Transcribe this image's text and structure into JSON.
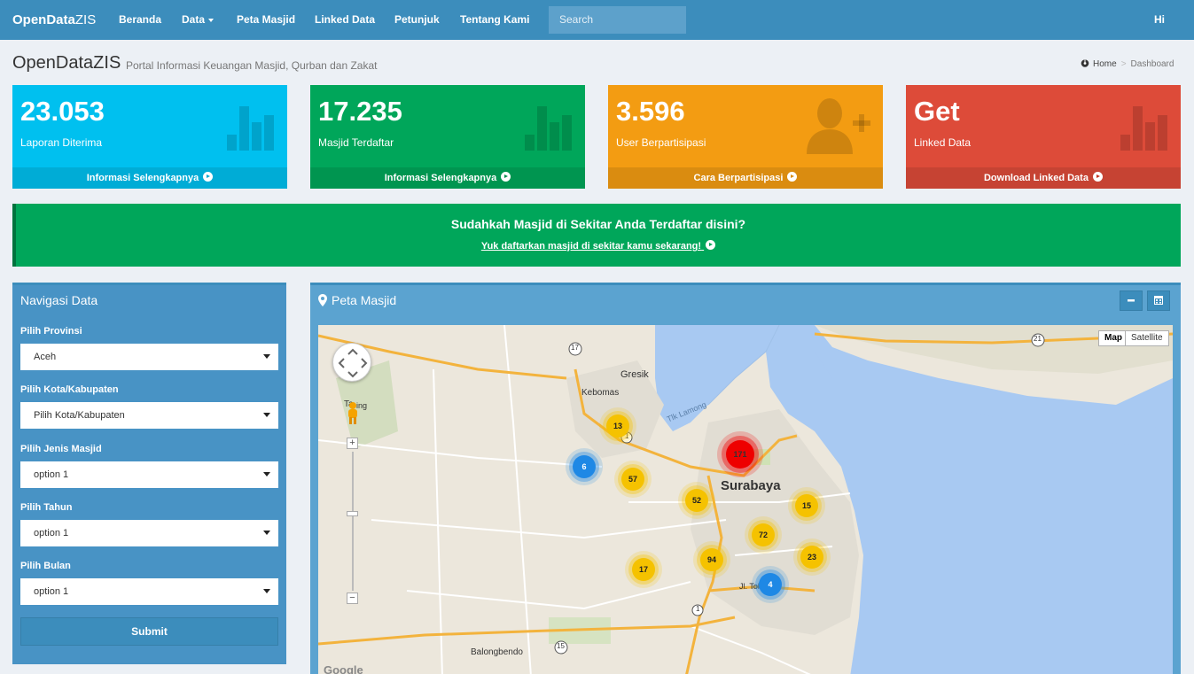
{
  "brand": {
    "bold": "OpenData",
    "light": "ZIS"
  },
  "nav": [
    {
      "label": "Beranda"
    },
    {
      "label": "Data"
    },
    {
      "label": "Peta Masjid"
    },
    {
      "label": "Linked Data"
    },
    {
      "label": "Petunjuk"
    },
    {
      "label": "Tentang Kami"
    }
  ],
  "search": {
    "placeholder": "Search"
  },
  "user": {
    "greeting": "Hi"
  },
  "header": {
    "title": "OpenDataZIS",
    "subtitle": "Portal Informasi Keuangan Masjid, Qurban dan Zakat",
    "breadcrumb": {
      "home": "Home",
      "current": "Dashboard"
    }
  },
  "stats": [
    {
      "value": "23.053",
      "label": "Laporan Diterima",
      "link": "Informasi Selengkapnya",
      "color": "#00c0ef",
      "icon": "bar-chart-icon"
    },
    {
      "value": "17.235",
      "label": "Masjid Terdaftar",
      "link": "Informasi Selengkapnya",
      "color": "#00a65a",
      "icon": "bar-chart-icon"
    },
    {
      "value": "3.596",
      "label": "User Berpartisipasi",
      "link": "Cara Berpartisipasi",
      "color": "#f39c12",
      "icon": "user-plus-icon"
    },
    {
      "value": "Get",
      "label": "Linked Data",
      "link": "Download Linked Data",
      "color": "#dd4b39",
      "icon": "bar-chart-icon"
    }
  ],
  "callout": {
    "title": "Sudahkah Masjid di Sekitar Anda Terdaftar disini?",
    "link": "Yuk daftarkan masjid di sekitar kamu sekarang!"
  },
  "filters": {
    "title": "Navigasi Data",
    "fields": [
      {
        "label": "Pilih Provinsi",
        "value": "Aceh"
      },
      {
        "label": "Pilih Kota/Kabupaten",
        "value": "Pilih Kota/Kabupaten"
      },
      {
        "label": "Pilih Jenis Masjid",
        "value": "option 1"
      },
      {
        "label": "Pilih Tahun",
        "value": "option 1"
      },
      {
        "label": "Pilih Bulan",
        "value": "option 1"
      }
    ],
    "submit": "Submit"
  },
  "map": {
    "title": "Peta Masjid",
    "type_map": "Map",
    "type_satellite": "Satellite",
    "labels": {
      "gresik": "Gresik",
      "kebomas": "Kebomas",
      "tlamong": "Tlk Lamong",
      "surabaya": "Surabaya",
      "balongbendo": "Balongbendo",
      "tg": "Ta",
      "tg2": "ing",
      "jalan": "Jl. Tol Waru",
      "road17": "17",
      "road21": "21",
      "road15": "15",
      "road1a": "1",
      "road1b": "1"
    },
    "clusters": [
      {
        "count": "13",
        "kind": "yellow"
      },
      {
        "count": "6",
        "kind": "blue"
      },
      {
        "count": "57",
        "kind": "yellow"
      },
      {
        "count": "171",
        "kind": "red"
      },
      {
        "count": "52",
        "kind": "yellow"
      },
      {
        "count": "15",
        "kind": "yellow"
      },
      {
        "count": "72",
        "kind": "yellow"
      },
      {
        "count": "23",
        "kind": "yellow"
      },
      {
        "count": "17",
        "kind": "yellow"
      },
      {
        "count": "94",
        "kind": "yellow"
      },
      {
        "count": "4",
        "kind": "blue"
      }
    ],
    "attribution": "Google"
  }
}
